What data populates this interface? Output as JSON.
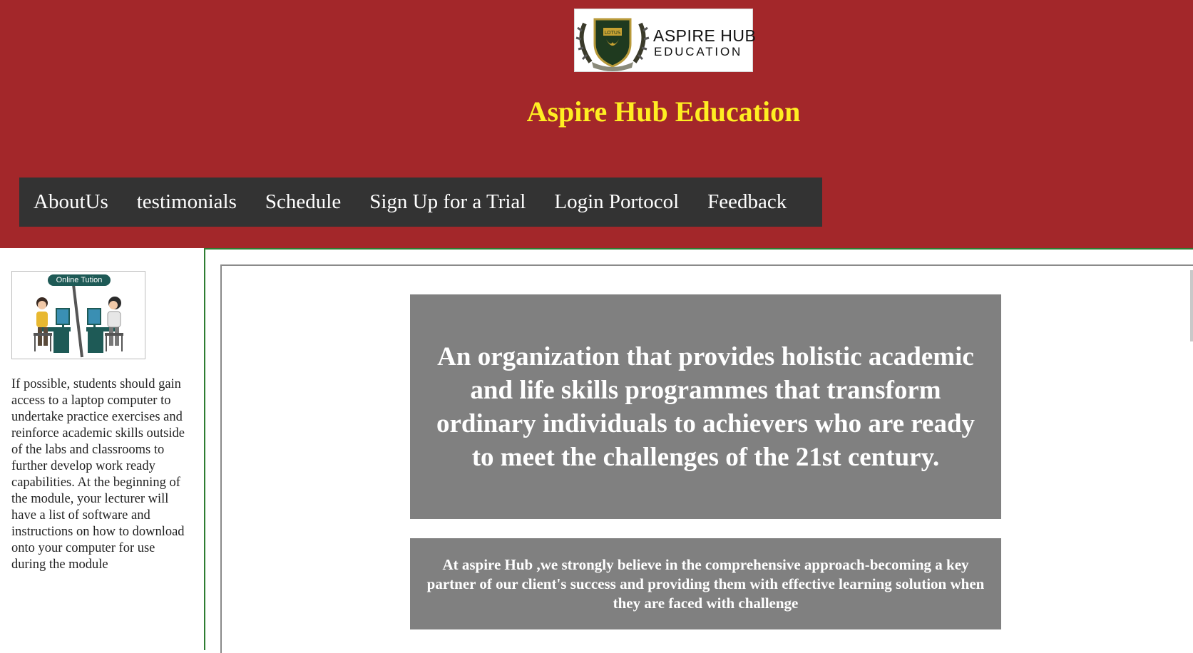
{
  "header": {
    "logo": {
      "line1": "ASPIRE HUB",
      "line2": "EDUCATION",
      "crest_text": "LOTUS"
    },
    "title": "Aspire Hub Education",
    "colors": {
      "background": "#a3272a",
      "title": "#ffee22",
      "nav_background": "#333333"
    }
  },
  "nav": {
    "items": [
      {
        "label": "AboutUs"
      },
      {
        "label": "testimonials"
      },
      {
        "label": "Schedule"
      },
      {
        "label": "Sign Up for a Trial"
      },
      {
        "label": "Login Portocol"
      },
      {
        "label": "Feedback"
      }
    ]
  },
  "sidebar": {
    "image_label": "Online Tution",
    "text": "If possible, students should gain access to a laptop computer to undertake practice exercises and reinforce academic skills outside of the labs and classrooms to further develop work ready capabilities. At the beginning of the module, your lecturer will have a list of software and instructions on how to download onto your computer for use during the module"
  },
  "main": {
    "mission": "An organization that provides holistic academic and life skills programmes that transform ordinary individuals to achievers who are ready to meet the challenges of the 21st century.",
    "belief": "At aspire Hub ,we strongly believe in the comprehensive approach-becoming a key partner of our client's success and providing them with effective learning solution when they are faced with challenge"
  }
}
